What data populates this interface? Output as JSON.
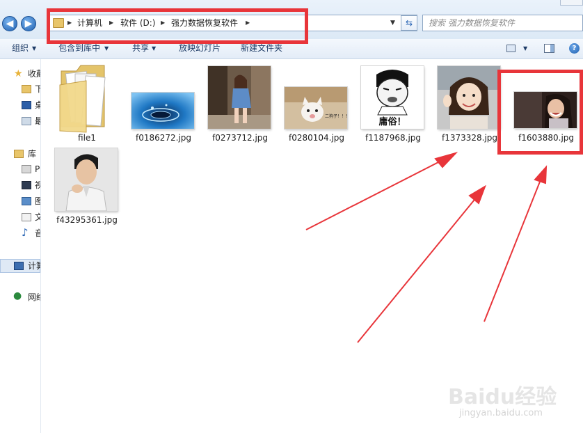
{
  "address": {
    "crumbs": [
      "计算机",
      "软件 (D:)",
      "强力数据恢复软件"
    ]
  },
  "search": {
    "placeholder": "搜索 强力数据恢复软件"
  },
  "toolbar": {
    "organize": "组织",
    "include_library": "包含到库中",
    "share": "共享",
    "slideshow": "放映幻灯片",
    "new_folder": "新建文件夹"
  },
  "nav": {
    "favorites": "收藏",
    "fav_items": [
      "下",
      "桌",
      "最"
    ],
    "libraries": "库",
    "lib_items": [
      "P",
      "视",
      "图",
      "文",
      "音"
    ],
    "computer": "计算",
    "network": "网络"
  },
  "files": [
    {
      "name": "file1",
      "type": "folder"
    },
    {
      "name": "f0186272.jpg",
      "type": "image",
      "subject": "water-drop"
    },
    {
      "name": "f0273712.jpg",
      "type": "image",
      "subject": "girl-in-denim"
    },
    {
      "name": "f0280104.jpg",
      "type": "image",
      "subject": "kitten",
      "caption": "二狗子！！！"
    },
    {
      "name": "f1187968.jpg",
      "type": "image",
      "subject": "meme-face",
      "caption": "庸俗！"
    },
    {
      "name": "f1373328.jpg",
      "type": "image",
      "subject": "little-girl"
    },
    {
      "name": "f1603880.jpg",
      "type": "image",
      "subject": "laughing-woman"
    },
    {
      "name": "f43295361.jpg",
      "type": "image",
      "subject": "man-portrait"
    }
  ],
  "watermark": {
    "brand": "Baidu经验",
    "url": "jingyan.baidu.com"
  },
  "colors": {
    "highlight_red": "#e8353a",
    "accent_blue": "#1d5fb0"
  }
}
